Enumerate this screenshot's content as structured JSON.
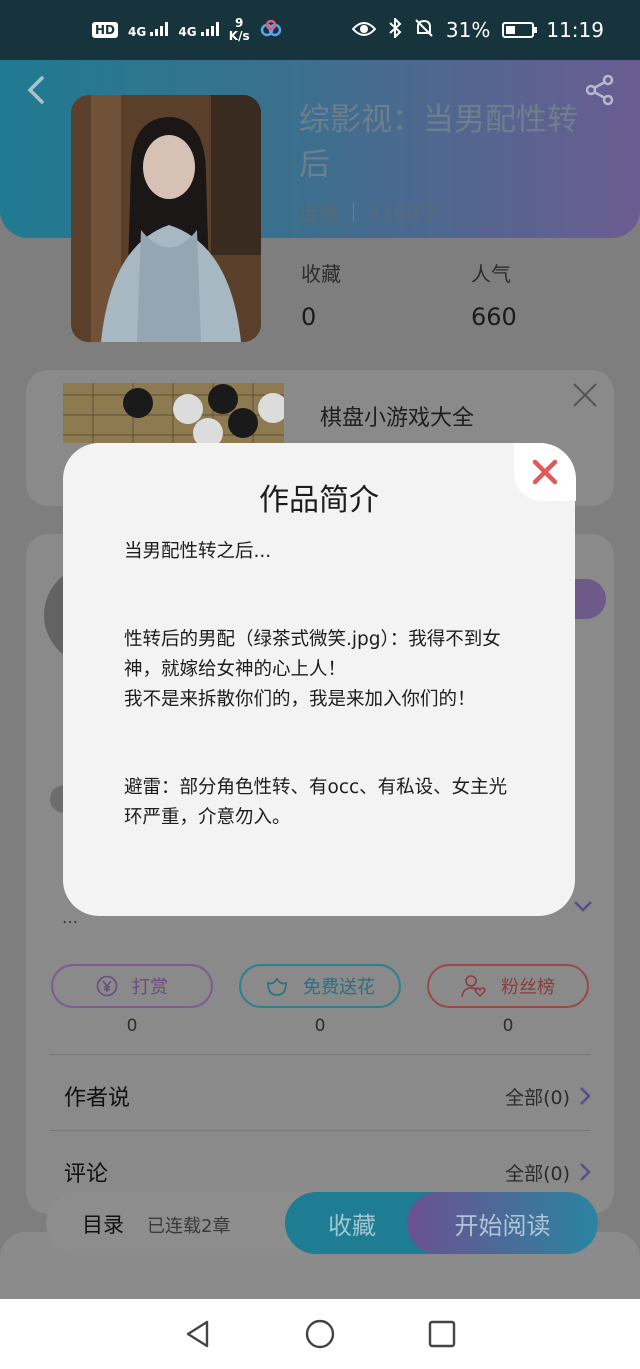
{
  "status_bar": {
    "hd": "HD",
    "signal1": "4G",
    "signal2": "4G",
    "speed_value": "9",
    "speed_unit": "K/s",
    "battery": "31%",
    "time": "11:19"
  },
  "book": {
    "title": "综影视：当男配性转后",
    "status": "连载",
    "word_count": "4169字",
    "stats": [
      {
        "label": "收藏",
        "value": "0"
      },
      {
        "label": "人气",
        "value": "660"
      }
    ]
  },
  "ad": {
    "title": "棋盘小游戏大全"
  },
  "actions": [
    {
      "label": "打赏",
      "count": "0",
      "icon": "yen-icon"
    },
    {
      "label": "免费送花",
      "count": "0",
      "icon": "flower-icon"
    },
    {
      "label": "粉丝榜",
      "count": "0",
      "icon": "user-heart-icon"
    }
  ],
  "sections": [
    {
      "title": "作者说",
      "more": "全部(0)"
    },
    {
      "title": "评论",
      "more": "全部(0)"
    }
  ],
  "bottom_bar": {
    "toc": "目录",
    "toc_sub": "已连载2章",
    "favorite": "收藏",
    "start_reading": "开始阅读"
  },
  "modal": {
    "title": "作品简介",
    "paragraphs": [
      "当男配性转之后...",
      "性转后的男配（绿茶式微笑.jpg）：我得不到女神，就嫁给女神的心上人！",
      "我不是来拆散你们的，我是来加入你们的！",
      "避雷：部分角色性转、有occ、有私设、女主光环严重，介意勿入。"
    ]
  },
  "colors": {
    "accent_teal": "#1f7d93",
    "accent_purple": "#6b5190",
    "close_red": "#e05a5a"
  }
}
